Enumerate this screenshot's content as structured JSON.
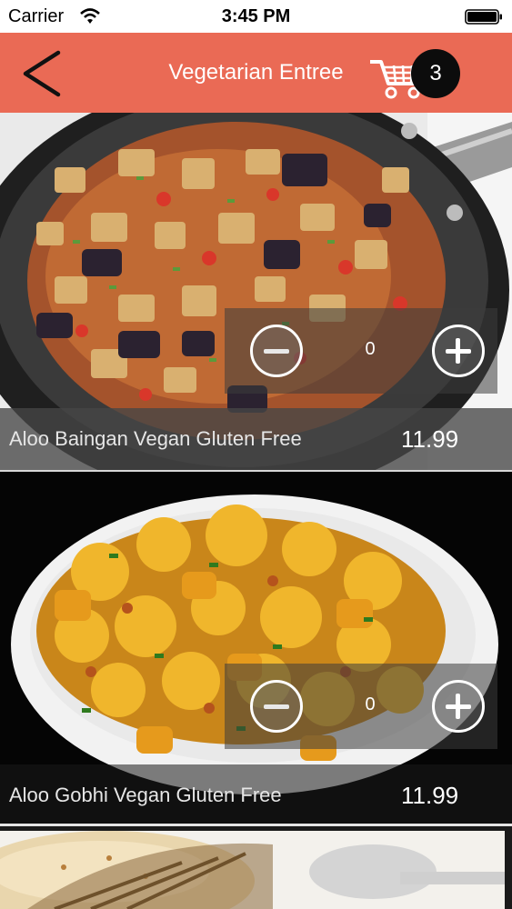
{
  "status_bar": {
    "carrier": "Carrier",
    "time": "3:45 PM"
  },
  "nav": {
    "title": "Vegetarian Entree",
    "back_icon": "chevron-left-icon",
    "cart_icon": "shopping-cart-icon",
    "cart_count": "3",
    "background_color": "#ea6a55"
  },
  "menu_items": [
    {
      "name": "Aloo Baingan Vegan Gluten Free",
      "price": "11.99",
      "quantity": "0",
      "image": "aloo baingan in black frying pan"
    },
    {
      "name": "Aloo Gobhi Vegan Gluten Free",
      "price": "11.99",
      "quantity": "0",
      "image": "aloo gobhi in white oval dish"
    }
  ]
}
